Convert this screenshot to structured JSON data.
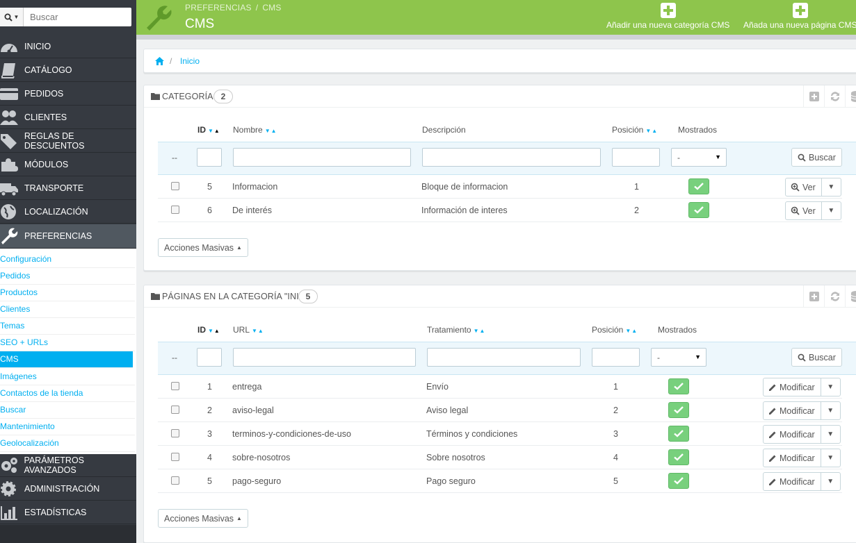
{
  "search": {
    "placeholder": "Buscar"
  },
  "sidebar": {
    "items": [
      {
        "label": "INICIO"
      },
      {
        "label": "CATÁLOGO"
      },
      {
        "label": "PEDIDOS"
      },
      {
        "label": "CLIENTES"
      },
      {
        "label": "REGLAS DE DESCUENTOS"
      },
      {
        "label": "MÓDULOS"
      },
      {
        "label": "TRANSPORTE"
      },
      {
        "label": "LOCALIZACIÓN"
      },
      {
        "label": "PREFERENCIAS"
      },
      {
        "label": "PARÁMETROS AVANZADOS"
      },
      {
        "label": "ADMINISTRACIÓN"
      },
      {
        "label": "ESTADÍSTICAS"
      }
    ],
    "submenu": [
      {
        "label": "Configuración"
      },
      {
        "label": "Pedidos"
      },
      {
        "label": "Productos"
      },
      {
        "label": "Clientes"
      },
      {
        "label": "Temas"
      },
      {
        "label": "SEO + URLs"
      },
      {
        "label": "CMS"
      },
      {
        "label": "Imágenes"
      },
      {
        "label": "Contactos de la tienda"
      },
      {
        "label": "Buscar"
      },
      {
        "label": "Mantenimiento"
      },
      {
        "label": "Geolocalización"
      }
    ]
  },
  "header": {
    "crumb_parent": "PREFERENCIAS",
    "crumb_separator": "/",
    "crumb_current": "CMS",
    "title": "CMS",
    "add_category_label": "Añadir una nueva categoría CMS",
    "add_page_label": "Añada una nueva página CMS",
    "accent_color": "#8ec54c"
  },
  "breadcrumb": {
    "separator": "/",
    "home_label": "Inicio"
  },
  "categories": {
    "title": "CATEGORÍAS",
    "count": "2",
    "columns": {
      "id": "ID",
      "name": "Nombre",
      "description": "Descripción",
      "position": "Posición",
      "shown": "Mostrados"
    },
    "filter": {
      "dash": "--",
      "select_value": "-",
      "search_label": "Buscar"
    },
    "rows": [
      {
        "id": "5",
        "name": "Informacion",
        "description": "Bloque de informacion",
        "position": "1",
        "action": "Ver"
      },
      {
        "id": "6",
        "name": "De interés",
        "description": "Información de interes",
        "position": "2",
        "action": "Ver"
      }
    ],
    "bulk_label": "Acciones Masivas"
  },
  "pages": {
    "title": "PÁGINAS EN LA CATEGORÍA \"INICIO\"",
    "count": "5",
    "columns": {
      "id": "ID",
      "url": "URL",
      "treatment": "Tratamiento",
      "position": "Posición",
      "shown": "Mostrados"
    },
    "filter": {
      "dash": "--",
      "select_value": "-",
      "search_label": "Buscar"
    },
    "rows": [
      {
        "id": "1",
        "url": "entrega",
        "treatment": "Envío",
        "position": "1",
        "action": "Modificar"
      },
      {
        "id": "2",
        "url": "aviso-legal",
        "treatment": "Aviso legal",
        "position": "2",
        "action": "Modificar"
      },
      {
        "id": "3",
        "url": "terminos-y-condiciones-de-uso",
        "treatment": "Términos y condiciones",
        "position": "3",
        "action": "Modificar"
      },
      {
        "id": "4",
        "url": "sobre-nosotros",
        "treatment": "Sobre nosotros",
        "position": "4",
        "action": "Modificar"
      },
      {
        "id": "5",
        "url": "pago-seguro",
        "treatment": "Pago seguro",
        "position": "5",
        "action": "Modificar"
      }
    ],
    "bulk_label": "Acciones Masivas"
  }
}
